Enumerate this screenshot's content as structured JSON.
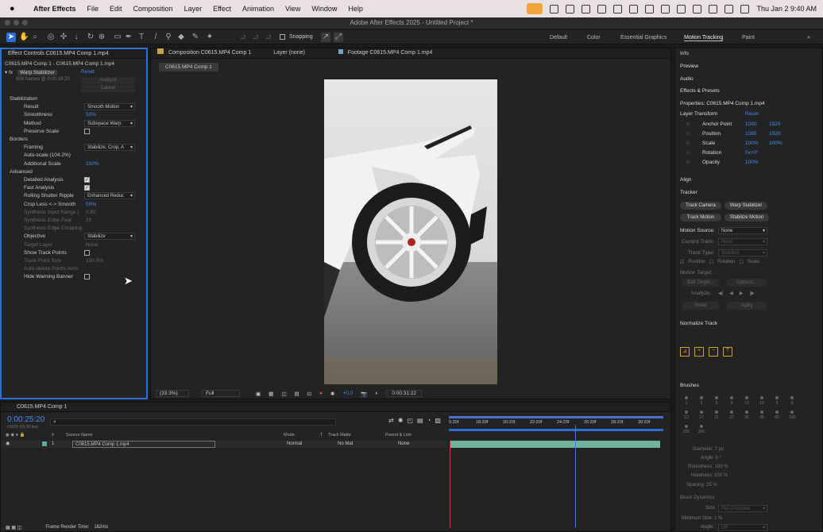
{
  "menubar": {
    "app": "After Effects",
    "items": [
      "File",
      "Edit",
      "Composition",
      "Layer",
      "Effect",
      "Animation",
      "View",
      "Window",
      "Help"
    ],
    "clock": "Thu Jan 2  9:40 AM"
  },
  "title": "Adobe After Effects 2025 - Untitled Project *",
  "toolbar": {
    "snapping": "Snapping",
    "workspaces": [
      "Default",
      "Color",
      "Essential Graphics",
      "Motion Tracking",
      "Paint"
    ]
  },
  "effect_controls": {
    "tab": "Effect Controls C0615.MP4 Comp 1.mp4",
    "subtitle": "C0615.MP4 Comp 1 - C0615.MP4 Comp 1.mp4",
    "effect": "Warp Stabilizer",
    "reset": "Reset",
    "frames": "909 frames @ 0:00:16:20",
    "analyze": "Analyze",
    "cancel": "Cancel",
    "rows": [
      {
        "l": "Stabilization",
        "v": "",
        "t": "group"
      },
      {
        "l": "Result",
        "v": "Smooth Motion",
        "t": "drop"
      },
      {
        "l": "Smoothness",
        "v": "50%",
        "t": "num"
      },
      {
        "l": "Method",
        "v": "Subspace Warp",
        "t": "drop"
      },
      {
        "l": "Preserve Scale",
        "v": "",
        "t": "cb"
      },
      {
        "l": "Borders",
        "v": "",
        "t": "group"
      },
      {
        "l": "Framing",
        "v": "Stabilize, Crop, A",
        "t": "drop"
      },
      {
        "l": "Auto-scale (104.2%)",
        "v": "",
        "t": "text"
      },
      {
        "l": "Additional Scale",
        "v": "100%",
        "t": "num"
      },
      {
        "l": "Advanced",
        "v": "",
        "t": "group"
      },
      {
        "l": "Detailed Analysis",
        "v": "on",
        "t": "cb"
      },
      {
        "l": "Fast Analysis",
        "v": "on",
        "t": "cb"
      },
      {
        "l": "Rolling Shutter Ripple",
        "v": "Enhanced Reduc",
        "t": "drop"
      },
      {
        "l": "Crop Less <-> Smooth",
        "v": "50%",
        "t": "num"
      },
      {
        "l": "Synthesis Input Range (",
        "v": "0.50",
        "t": "dim"
      },
      {
        "l": "Synthesis Edge Feat",
        "v": "10",
        "t": "dim"
      },
      {
        "l": "Synthesis Edge Cropping",
        "v": "",
        "t": "dim"
      },
      {
        "l": "Objective",
        "v": "Stabilize",
        "t": "drop"
      },
      {
        "l": "Target Layer",
        "v": "None",
        "t": "dim"
      },
      {
        "l": "Show Track Points",
        "v": "",
        "t": "cb"
      },
      {
        "l": "Track Point Size",
        "v": "100.0%",
        "t": "dim"
      },
      {
        "l": "Auto-delete Points Acro",
        "v": "",
        "t": "dim"
      },
      {
        "l": "Hide Warning Banner",
        "v": "",
        "t": "cb"
      }
    ]
  },
  "composition": {
    "tab": "Composition C0615.MP4 Comp 1",
    "layer_tab": "Layer (none)",
    "footage_tab": "Footage C0615.MP4 Comp 1.mp4",
    "comp_button": "C0615.MP4 Comp 1",
    "zoom": "(33.3%)",
    "resolution": "Full",
    "exposure": "+0.0",
    "timecode": "0:00:31:22"
  },
  "timeline": {
    "tab": "C0615.MP4 Comp 1",
    "time": "0:00:25:20",
    "fps": "01520 (60.00 fps)",
    "cols": [
      "#",
      "Source Name",
      "Mode",
      "T",
      "Track Matte",
      "Parent & Link"
    ],
    "layer": {
      "num": "1",
      "name": "C0615.MP4 Comp 1.mp4",
      "mode": "Normal",
      "matte": "No Mat",
      "parent": "None"
    },
    "ticks": [
      "5:20f",
      "18:20f",
      "20:20f",
      "22:20f",
      "24:20f",
      "26:20f",
      "28:20f",
      "30:20f"
    ],
    "render": "Frame Render Time:",
    "render_val": "162ms"
  },
  "right": {
    "sections": [
      "Info",
      "Preview",
      "Audio",
      "Effects & Presets"
    ],
    "properties": "Properties: C0615.MP4 Comp 1.mp4",
    "layer_transform": "Layer Transform",
    "reset": "Reset",
    "props": [
      {
        "l": "Anchor Point",
        "a": "1080",
        "b": "1920"
      },
      {
        "l": "Position",
        "a": "1080",
        "b": "1920"
      },
      {
        "l": "Scale",
        "a": "100%",
        "b": "100%"
      },
      {
        "l": "Rotation",
        "a": "0x+0°",
        "b": ""
      },
      {
        "l": "Opacity",
        "a": "100%",
        "b": ""
      }
    ],
    "align": "Align",
    "tracker": "Tracker",
    "btns": [
      "Track Camera",
      "Warp Stabilizer",
      "Track Motion",
      "Stabilize Motion"
    ],
    "motion_source": "Motion Source:",
    "motion_source_val": "None",
    "current_track": "Current Track:",
    "current_track_val": "None",
    "track_type": "Track Type:",
    "track_type_val": "Stabilize",
    "checks": [
      "Position",
      "Rotation",
      "Scale"
    ],
    "motion_target": "Motion Target:",
    "edit_target": "Edit Target...",
    "options": "Options...",
    "analyze": "Analyze:",
    "reset2": "Reset",
    "apply": "Apply",
    "normalize": "Normalize Track",
    "brushes": "Brushes",
    "brush_sizes": [
      "1",
      "3",
      "5",
      "9",
      "13",
      "19",
      "5",
      "9",
      "13",
      "17",
      "21",
      "27",
      "35",
      "45",
      "65",
      "100",
      "200",
      "300"
    ],
    "diameter": "Diameter: 7 px",
    "angle": "Angle: 0 °",
    "roundness": "Roundness: 100 %",
    "hardness": "Hardness: 100 %",
    "spacing": "Spacing: 25 %",
    "dynamics": "Brush Dynamics",
    "size_l": "Size:",
    "size_v": "Pen Pressure",
    "minsize": "Minimum Size: 1 %",
    "angle2": "Angle:",
    "angle2_v": "Off"
  }
}
